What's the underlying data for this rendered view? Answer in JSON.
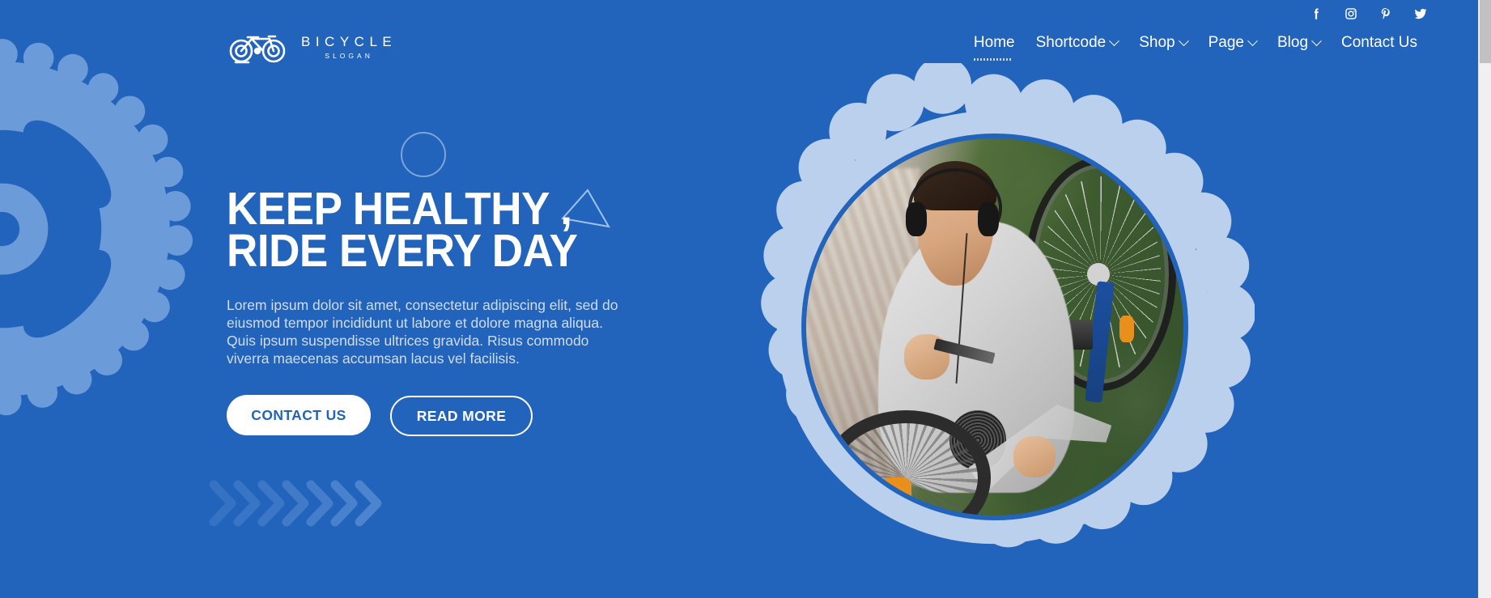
{
  "page": {
    "background_color": "#2263bc",
    "accent_light": "#bbd0ec",
    "gear_blue": "#6b9bd8",
    "text_on_blue": "#ffffff"
  },
  "social": {
    "items": [
      {
        "name": "facebook",
        "icon": "facebook-icon",
        "label": "Facebook"
      },
      {
        "name": "instagram",
        "icon": "instagram-icon",
        "label": "Instagram"
      },
      {
        "name": "pinterest",
        "icon": "pinterest-icon",
        "label": "Pinterest"
      },
      {
        "name": "twitter",
        "icon": "twitter-icon",
        "label": "Twitter"
      }
    ]
  },
  "logo": {
    "icon": "bicycle-icon",
    "title": "BICYCLE",
    "subtitle": "SLOGAN"
  },
  "nav": {
    "items": [
      {
        "label": "Home",
        "has_dropdown": false,
        "active": true
      },
      {
        "label": "Shortcode",
        "has_dropdown": true,
        "active": false
      },
      {
        "label": "Shop",
        "has_dropdown": true,
        "active": false
      },
      {
        "label": "Page",
        "has_dropdown": true,
        "active": false
      },
      {
        "label": "Blog",
        "has_dropdown": true,
        "active": false
      },
      {
        "label": "Contact Us",
        "has_dropdown": false,
        "active": false
      }
    ]
  },
  "hero": {
    "title": "KEEP HEALTHY ,\nRIDE EVERY DAY",
    "description": "Lorem ipsum dolor sit amet, consectetur adipiscing elit, sed do eiusmod tempor incididunt ut labore et dolore magna aliqua. Quis ipsum suspendisse ultrices gravida. Risus commodo viverra maecenas accumsan lacus vel facilisis.",
    "primary_button": "CONTACT US",
    "secondary_button": "READ MORE",
    "image_alt": "Man wearing headphones repairing a bicycle wheel outdoors"
  },
  "decorations": {
    "circle": "outline-circle",
    "triangle": "outline-triangle",
    "chevrons": "chevron-arrows",
    "left_gear": "chainring-gear",
    "right_sprocket": "sprocket-frame"
  },
  "scrollbar": {
    "thumb_position": "top",
    "track_color": "#f0f0f0",
    "thumb_color": "#c1c1c1"
  }
}
